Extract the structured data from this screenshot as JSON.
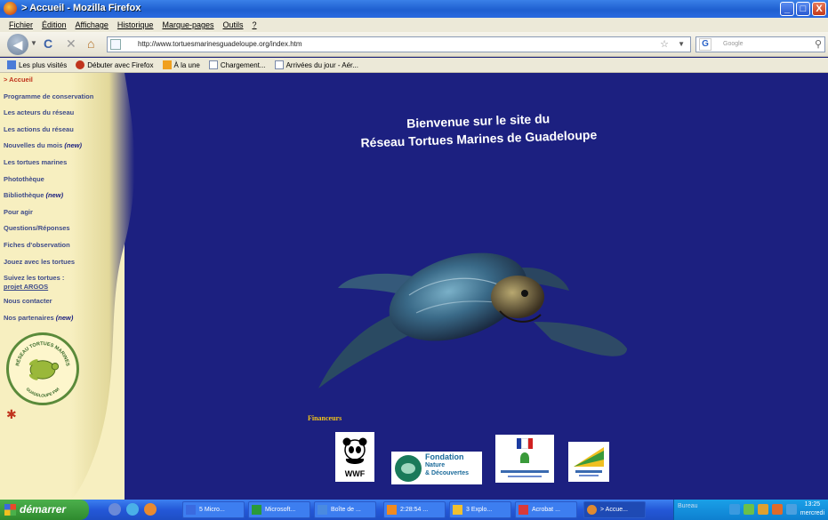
{
  "window": {
    "title": "> Accueil - Mozilla Firefox",
    "min": "_",
    "max": "□",
    "close": "X"
  },
  "menu": [
    "Fichier",
    "Édition",
    "Affichage",
    "Historique",
    "Marque-pages",
    "Outils",
    "?"
  ],
  "nav": {
    "url": "http://www.tortuesmarinesguadeloupe.org/index.htm",
    "search_placeholder": "Google",
    "search_engine_glyph": "G"
  },
  "bookmarks": [
    {
      "label": "Les plus visités",
      "icon": "blue"
    },
    {
      "label": "Débuter avec Firefox",
      "icon": "red"
    },
    {
      "label": "À la une",
      "icon": "rss"
    },
    {
      "label": "Chargement...",
      "icon": "page"
    },
    {
      "label": "Arrivées du jour - Aér...",
      "icon": "page"
    }
  ],
  "sidebar": {
    "links": [
      {
        "label": "> Accueil",
        "new": ""
      },
      {
        "label": "Programme de conservation",
        "new": ""
      },
      {
        "label": "Les acteurs du réseau",
        "new": ""
      },
      {
        "label": "Les actions du réseau",
        "new": ""
      },
      {
        "label": "Nouvelles du mois ",
        "new": "(new)"
      },
      {
        "label": "Les tortues marines",
        "new": ""
      },
      {
        "label": "Photothèque",
        "new": ""
      },
      {
        "label": "Bibliothèque ",
        "new": "(new)"
      },
      {
        "label": "Pour agir",
        "new": ""
      },
      {
        "label": "Questions/Réponses",
        "new": ""
      },
      {
        "label": "Fiches d'observation",
        "new": ""
      },
      {
        "label": "Jouez avec les tortues",
        "new": ""
      }
    ],
    "argos_line1": "Suivez les tortues :",
    "argos_line2": "projet ARGOS",
    "contact": "Nous contacter",
    "partners": "Nos partenaires ",
    "partners_new": "(new)",
    "logo_text_top": "RÉSEAU TORTUES MARINES",
    "logo_text_bottom": "GUADELOUPE FWI"
  },
  "main": {
    "welcome_line1": "Bienvenue sur le site du",
    "welcome_line2": "Réseau Tortues Marines de Guadeloupe",
    "financeurs": "Financeurs",
    "wwf": "WWF",
    "fondation": [
      "Fondation",
      "Nature",
      "& Découvertes"
    ]
  },
  "taskbar": {
    "start": "démarrer",
    "tasks": [
      {
        "label": "5 Micro...",
        "color": "#3a6ae0"
      },
      {
        "label": "Microsoft...",
        "color": "#2a9a3a"
      },
      {
        "label": "Boîte de ...",
        "color": "#4a8ae0"
      },
      {
        "label": "2:28:54 ...",
        "color": "#f08a20"
      },
      {
        "label": "3 Explo...",
        "color": "#f0c030"
      },
      {
        "label": "Acrobat ...",
        "color": "#d83a3a"
      },
      {
        "label": "> Accue...",
        "color": "#e08a30"
      }
    ],
    "tray_label": "Bureau",
    "time": "13:25",
    "day": "mercredi"
  },
  "colors": {
    "page_bg": "#1c2080",
    "sidebar_bg": "#f7efc0",
    "link": "#3e4b8a",
    "active_link": "#c0341d",
    "gold": "#f2c41a"
  }
}
